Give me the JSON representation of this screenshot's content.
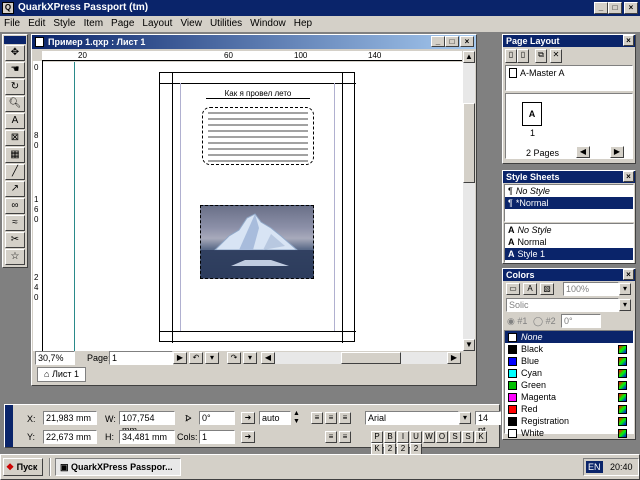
{
  "app": {
    "title": "QuarkXPress Passport (tm)"
  },
  "menu": [
    "File",
    "Edit",
    "Style",
    "Item",
    "Page",
    "Layout",
    "View",
    "Utilities",
    "Window",
    "Hep"
  ],
  "doc": {
    "title": "Пример 1.qxp : Лист 1",
    "ruler_labels": [
      "20",
      "60",
      "100",
      "140"
    ],
    "vruler_labels": [
      "0",
      "8",
      "0",
      "1",
      "6",
      "0",
      "2",
      "4",
      "0"
    ],
    "page_heading": "Как я провел лето",
    "zoom": "30,7%",
    "page_label": "Page:",
    "page_value": "1",
    "sheet_tab": "Лист 1"
  },
  "page_layout": {
    "title": "Page Layout",
    "master": "A-Master A",
    "page_letter": "A",
    "page_number": "1",
    "pages_count": "2 Pages"
  },
  "style_sheets": {
    "title": "Style Sheets",
    "para": [
      {
        "label": "No Style",
        "selected": false
      },
      {
        "label": "*Normal",
        "selected": true
      }
    ],
    "char": [
      {
        "label": "No Style",
        "selected": false
      },
      {
        "label": "Normal",
        "selected": false
      },
      {
        "label": "Style 1",
        "selected": true
      }
    ]
  },
  "colors": {
    "title": "Colors",
    "shade": "100%",
    "blend": "Solic",
    "angle_label": "#1",
    "angle2_label": "#2",
    "angle_value": "0°",
    "items": [
      {
        "name": "None",
        "color": "#ffffff",
        "selected": true
      },
      {
        "name": "Black",
        "color": "#000000"
      },
      {
        "name": "Blue",
        "color": "#0000ff"
      },
      {
        "name": "Cyan",
        "color": "#00ffff"
      },
      {
        "name": "Green",
        "color": "#00c000"
      },
      {
        "name": "Magenta",
        "color": "#ff00ff"
      },
      {
        "name": "Red",
        "color": "#ff0000"
      },
      {
        "name": "Registration",
        "color": "#000000"
      },
      {
        "name": "White",
        "color": "#ffffff"
      }
    ]
  },
  "measurements": {
    "x_label": "X:",
    "x_value": "21,983 mm",
    "y_label": "Y:",
    "y_value": "22,673 mm",
    "w_label": "W:",
    "w_value": "107,754 mm",
    "h_label": "H:",
    "h_value": "34,481 mm",
    "angle_value": "0°",
    "cols_label": "Cols:",
    "cols_value": "1",
    "leading": "auto",
    "font": "Arial",
    "size": "14 pt",
    "style_buttons": [
      "P",
      "B",
      "I",
      "U",
      "W",
      "O",
      "S",
      "S",
      "K",
      "K",
      "2",
      "2",
      "2"
    ]
  },
  "taskbar": {
    "start": "Пуск",
    "task": "QuarkXPress Passpor...",
    "lang": "EN",
    "clock": "20:40"
  }
}
